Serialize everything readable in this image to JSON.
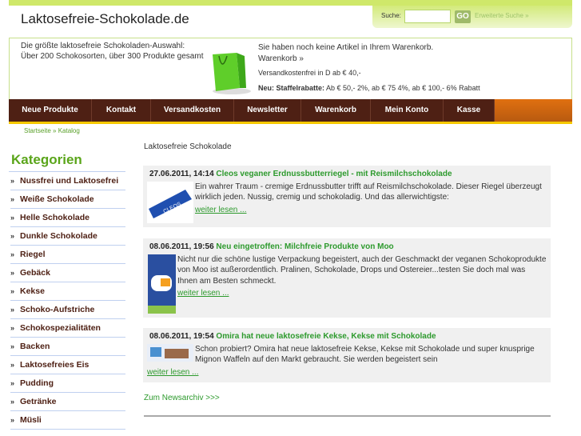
{
  "header": {
    "title": "Laktosefreie-Schokolade.de",
    "search_label": "Suche:",
    "search_value": "",
    "go": "GO",
    "advanced": "Erweiterte Suche »"
  },
  "info": {
    "tagline1": "Die größte laktosefreie Schokoladen-Auswahl:",
    "tagline2": "Über 200 Schokosorten, über 300 Produkte gesamt",
    "cart_empty": "Sie haben noch keine Artikel in Ihrem Warenkorb.",
    "cart_link": "Warenkorb »",
    "shipping": "Versandkostenfrei in D ab € 40,-",
    "discount_label": "Neu: Staffelrabatte:",
    "discount_text": " Ab € 50,- 2%, ab € 75 4%, ab € 100,- 6% Rabatt"
  },
  "nav": [
    {
      "label": "Neue Produkte"
    },
    {
      "label": "Kontakt"
    },
    {
      "label": "Versandkosten"
    },
    {
      "label": "Newsletter"
    },
    {
      "label": "Warenkorb"
    },
    {
      "label": "Mein Konto"
    },
    {
      "label": "Kasse"
    }
  ],
  "breadcrumb": "Startseite » Katalog",
  "sidebar": {
    "title": "Kategorien",
    "items": [
      "Nussfrei und Laktosefrei",
      "Weiße Schokolade",
      "Helle Schokolade",
      "Dunkle Schokolade",
      "Riegel",
      "Gebäck",
      "Kekse",
      "Schoko-Aufstriche",
      "Schokospezialitäten",
      "Backen",
      "Laktosefreies Eis",
      "Pudding",
      "Getränke",
      "Müsli"
    ]
  },
  "main": {
    "heading": "Laktosefreie Schokolade",
    "news": [
      {
        "date": "27.06.2011, 14:14",
        "title": "Cleos veganer Erdnussbutterriegel - mit Reismilchschokolade",
        "text": "Ein wahrer Traum - cremige Erdnussbutter trifft auf Reismilchschokolade. Dieser Riegel überzeugt wirklich jeden. Nussig, cremig und schokoladig. Und das allerwichtigste:",
        "more": "weiter lesen ..."
      },
      {
        "date": "08.06.2011, 19:56",
        "title": "Neu eingetroffen: Milchfreie Produkte von Moo",
        "text": "Nicht nur die schöne lustige Verpackung begeistert, auch der Geschmackt der veganen Schokoprodukte von Moo ist außerordentlich. Pralinen, Schokolade, Drops und Ostereier...testen Sie doch mal was Ihnen am Besten schmeckt.",
        "more": "weiter lesen ..."
      },
      {
        "date": "08.06.2011, 19:54",
        "title": "Omira hat neue laktosefreie Kekse, Kekse mit Schokolade",
        "text": "Schon probiert? Omira hat neue laktosefreie Kekse, Kekse mit Schokolade und super knusprige Mignon Waffeln auf den Markt gebraucht. Sie werden begeistert sein",
        "more": "weiter lesen ..."
      }
    ],
    "archive": "Zum Newsarchiv >>>"
  }
}
